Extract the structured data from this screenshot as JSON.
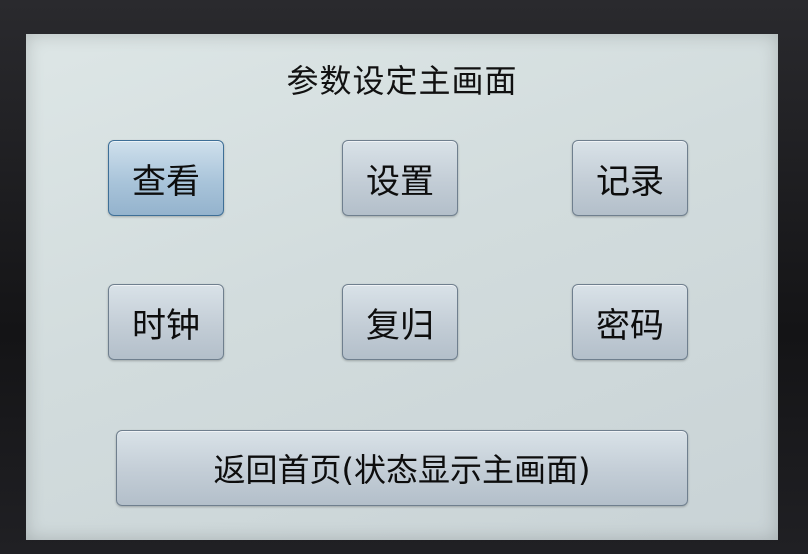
{
  "screen": {
    "title": "参数设定主画面"
  },
  "buttons": {
    "view": "查看",
    "settings": "设置",
    "records": "记录",
    "clock": "时钟",
    "reset": "复归",
    "password": "密码",
    "return_home": "返回首页(状态显示主画面)"
  },
  "colors": {
    "screen_background": "#d6dfe0",
    "button_fill": "#c3cdd6",
    "selected_button_fill": "#a9c4da",
    "button_border": "#6f7f8e"
  }
}
